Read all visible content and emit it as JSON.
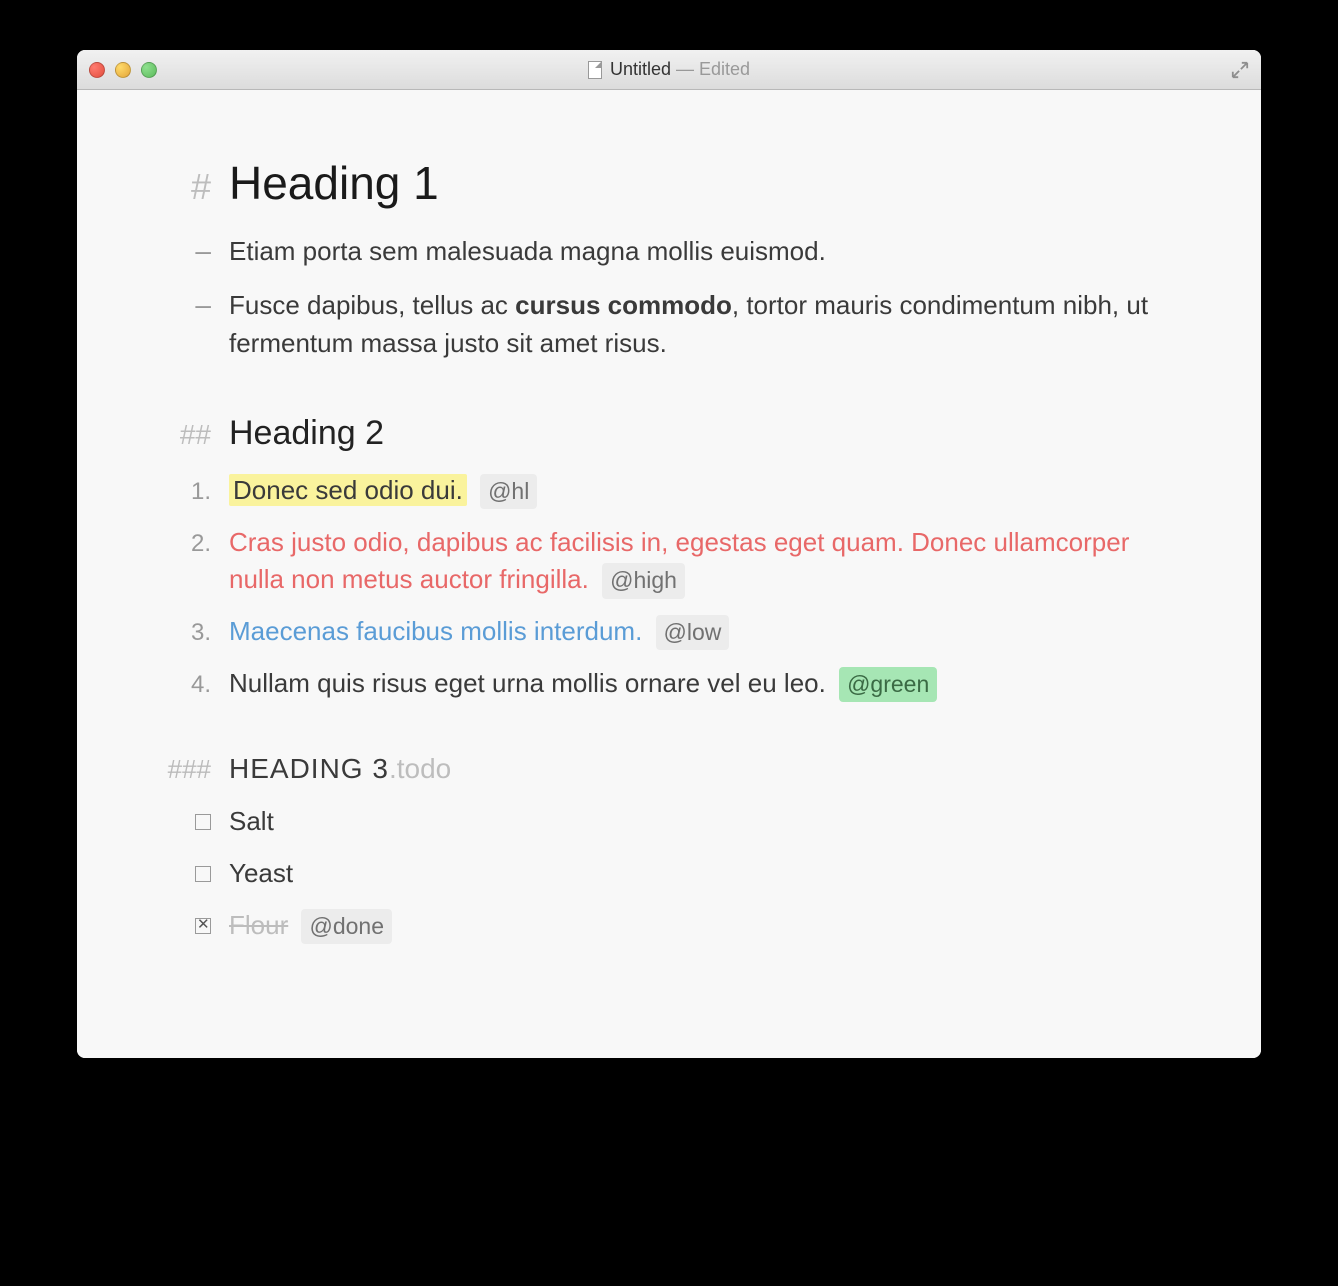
{
  "window": {
    "title": "Untitled",
    "status": "— Edited"
  },
  "document": {
    "h1": {
      "marker": "#",
      "text": "Heading 1"
    },
    "bullets": [
      {
        "marker": "–",
        "text": "Etiam porta sem malesuada magna mollis euismod."
      },
      {
        "marker": "–",
        "before": "Fusce dapibus, tellus ac ",
        "bold": "cursus commodo",
        "after": ", tortor mauris condimentum nibh, ut fermentum massa justo sit amet risus."
      }
    ],
    "h2": {
      "marker": "##",
      "text": "Heading 2"
    },
    "numbered": [
      {
        "marker": "1.",
        "text": "Donec sed odio dui.",
        "tag": "@hl",
        "style": "highlight"
      },
      {
        "marker": "2.",
        "text": "Cras justo odio, dapibus ac facilisis in, egestas eget quam. Donec ullamcorper nulla non metus auctor fringilla.",
        "tag": "@high",
        "style": "red"
      },
      {
        "marker": "3.",
        "text": "Maecenas faucibus mollis interdum.",
        "tag": "@low",
        "style": "blue"
      },
      {
        "marker": "4.",
        "text": "Nullam quis risus eget urna mollis ornare vel eu leo.",
        "tag": "@green",
        "style": "plain",
        "tag_style": "green"
      }
    ],
    "h3": {
      "marker": "###",
      "text": "HEADING 3",
      "suffix": ".todo"
    },
    "todos": [
      {
        "checked": false,
        "text": "Salt"
      },
      {
        "checked": false,
        "text": "Yeast"
      },
      {
        "checked": true,
        "text": "Flour",
        "tag": "@done"
      }
    ]
  }
}
